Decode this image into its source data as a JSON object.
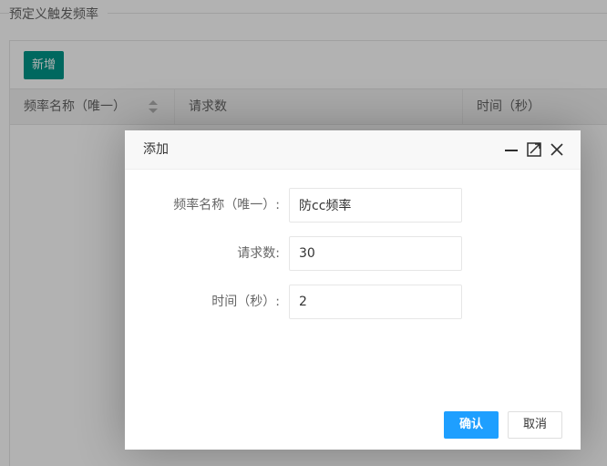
{
  "section": {
    "title": "预定义触发频率"
  },
  "toolbar": {
    "add_label": "新增"
  },
  "table": {
    "columns": [
      "频率名称（唯一）",
      "请求数",
      "时间（秒）"
    ]
  },
  "dialog": {
    "title": "添加",
    "fields": [
      {
        "label": "频率名称（唯一）:",
        "value": "防cc频率"
      },
      {
        "label": "请求数:",
        "value": "30"
      },
      {
        "label": "时间（秒）:",
        "value": "2"
      }
    ],
    "confirm_label": "确认",
    "cancel_label": "取消",
    "header_icons": [
      "minimize-icon",
      "maximize-icon",
      "close-icon"
    ]
  },
  "colors": {
    "add_button": "#009688",
    "confirm_button": "#1e9fff",
    "overlay": "rgba(0,0,0,0.3)"
  }
}
